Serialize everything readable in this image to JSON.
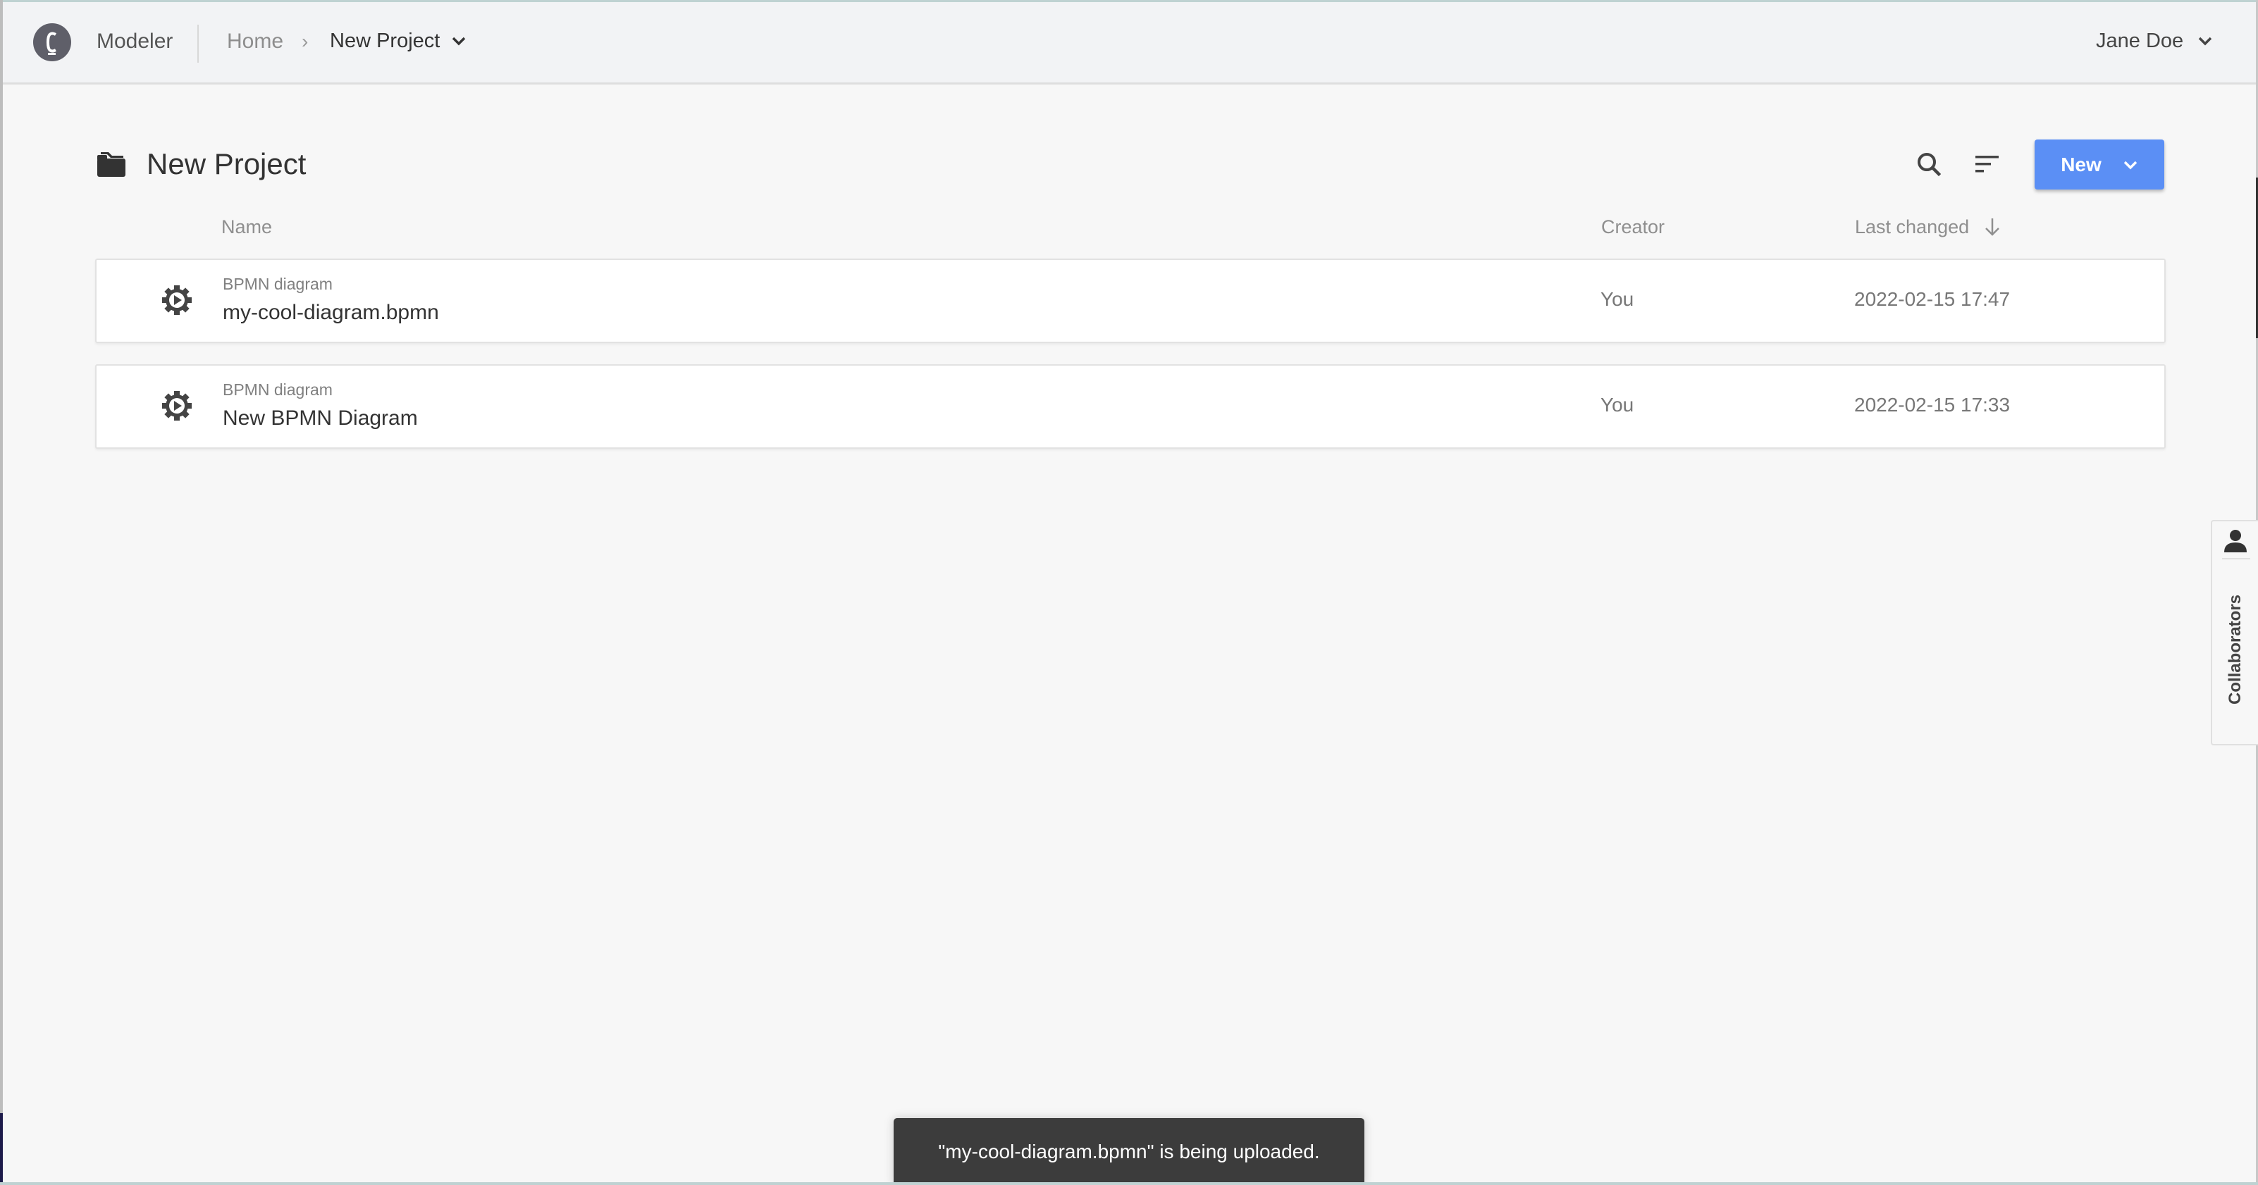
{
  "header": {
    "app_name": "Modeler",
    "breadcrumb": {
      "home": "Home",
      "separator": "›",
      "current": "New Project"
    },
    "user_name": "Jane Doe",
    "logo_letter": "C"
  },
  "page": {
    "title": "New Project",
    "icons": {
      "folder": "folder-icon",
      "search": "search-icon",
      "sort": "sort-icon"
    },
    "new_button_label": "New"
  },
  "table": {
    "columns": {
      "name": "Name",
      "creator": "Creator",
      "last_changed": "Last changed"
    },
    "sort": {
      "column": "last_changed",
      "direction": "descending"
    },
    "rows": [
      {
        "type": "BPMN diagram",
        "name": "my-cool-diagram.bpmn",
        "creator": "You",
        "last_changed": "2022-02-15 17:47"
      },
      {
        "type": "BPMN diagram",
        "name": "New BPMN Diagram",
        "creator": "You",
        "last_changed": "2022-02-15 17:33"
      }
    ]
  },
  "collaborators_tab": {
    "label": "Collaborators"
  },
  "toast": {
    "message": "\"my-cool-diagram.bpmn\" is being uploaded."
  },
  "colors": {
    "accent": "#5b8ff5",
    "toast_bg": "#3c3c3c",
    "logo": "#5f5f69",
    "text_primary": "#333333",
    "text_muted": "#777777"
  }
}
